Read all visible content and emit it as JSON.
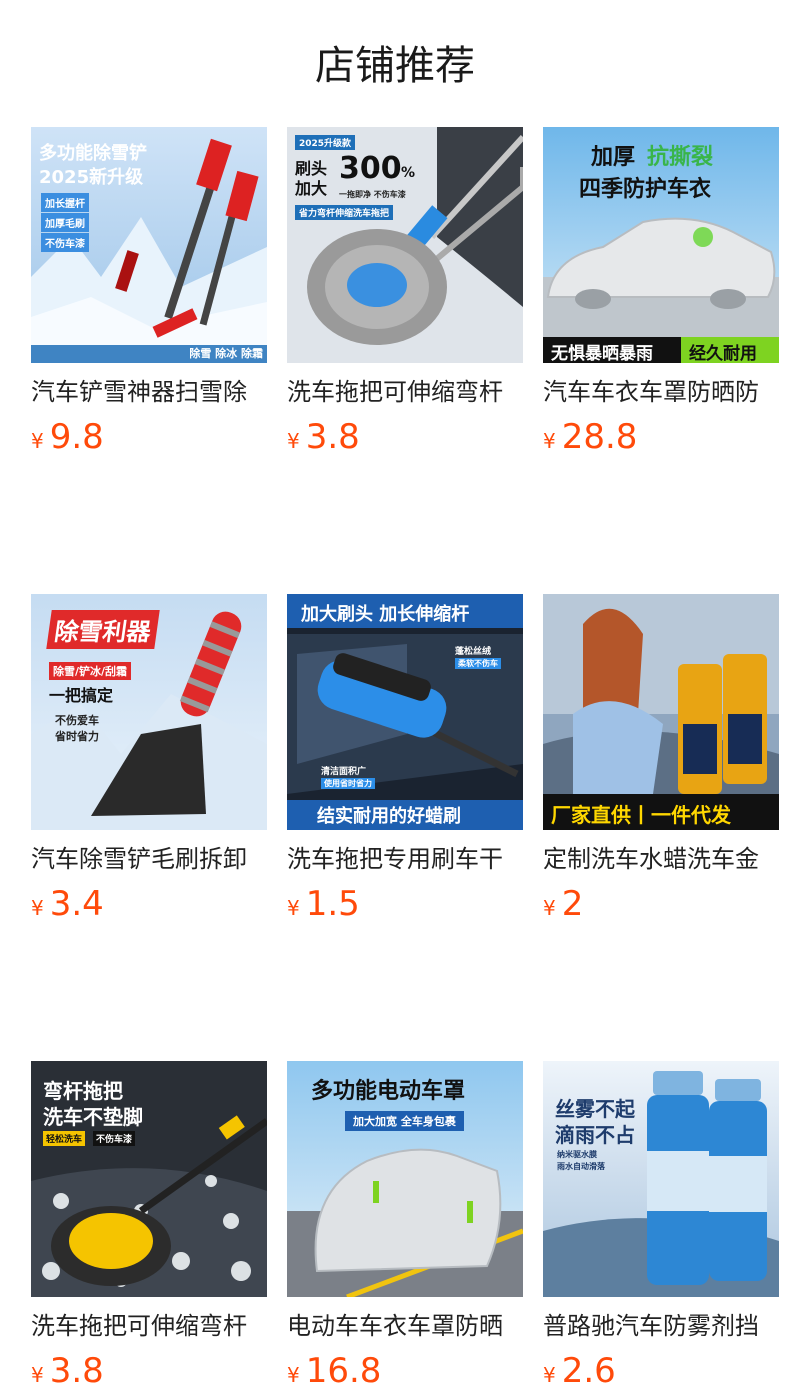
{
  "page": {
    "title": "店铺推荐"
  },
  "currency": "¥",
  "products": [
    {
      "name": "汽车铲雪神器扫雪除",
      "price": "9.8",
      "icon": "snow-shovel-brush-icon",
      "overlay": [
        "多功能除雪铲",
        "2025新升级",
        "加长握杆",
        "加厚毛刷",
        "不伤车漆",
        "除雪 除冰 除霜"
      ]
    },
    {
      "name": "洗车拖把可伸缩弯杆",
      "price": "3.8",
      "icon": "car-wash-mop-icon",
      "overlay": [
        "2025升级款",
        "刷头",
        "加大",
        "300",
        "%",
        "一拖即净 不伤车漆",
        "省力弯杆伸缩洗车拖把"
      ]
    },
    {
      "name": "汽车车衣车罩防晒防",
      "price": "28.8",
      "icon": "car-cover-icon",
      "overlay": [
        "加厚",
        "抗撕裂",
        "四季防护车衣",
        "无惧暴晒暴雨",
        "经久耐用"
      ]
    },
    {
      "name": "汽车除雪铲毛刷拆卸",
      "price": "3.4",
      "icon": "ice-scraper-icon",
      "overlay": [
        "除雪利器",
        "除雪/铲冰/刮霜",
        "一把搞定",
        "不伤爱车",
        "省时省力"
      ]
    },
    {
      "name": "洗车拖把专用刷车干",
      "price": "1.5",
      "icon": "wax-brush-icon",
      "overlay": [
        "加大刷头 加长伸缩杆",
        "蓬松丝绒",
        "柔软不伤车",
        "清洁面积广",
        "使用省时省力",
        "结实耐用的好蜡刷"
      ]
    },
    {
      "name": "定制洗车水蜡洗车金",
      "price": "2",
      "icon": "car-wash-liquid-icon",
      "overlay": [
        "厂家直供丨一件代发"
      ]
    },
    {
      "name": "洗车拖把可伸缩弯杆",
      "price": "3.8",
      "icon": "bent-pole-mop-icon",
      "overlay": [
        "弯杆拖把",
        "洗车不垫脚",
        "轻松洗车",
        "不伤车漆"
      ]
    },
    {
      "name": "电动车车衣车罩防晒",
      "price": "16.8",
      "icon": "scooter-cover-icon",
      "overlay": [
        "多功能电动车罩",
        "加大加宽 全车身包裹"
      ]
    },
    {
      "name": "普路驰汽车防雾剂挡",
      "price": "2.6",
      "icon": "anti-fog-spray-icon",
      "overlay": [
        "丝雾不起",
        "滴雨不占",
        "纳米驱水膜",
        "雨水自动滑落"
      ]
    }
  ],
  "colors": {
    "price": "#ff4a0a",
    "title": "#1a1a1a"
  }
}
